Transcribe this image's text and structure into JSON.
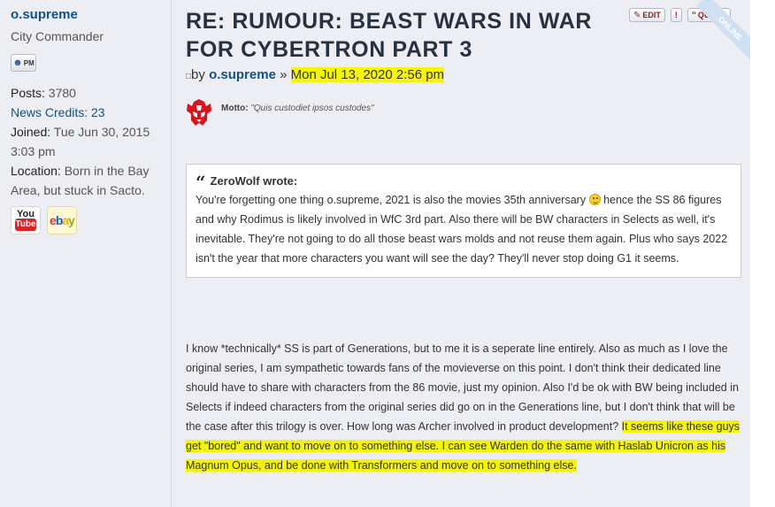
{
  "profile": {
    "username": "o.supreme",
    "rank": "City Commander",
    "pm_label": "PM",
    "posts_label": "Posts:",
    "posts_value": "3780",
    "credits_label": "News Credits: 23",
    "joined_label": "Joined:",
    "joined_value": "Tue Jun 30, 2015 3:03 pm",
    "location_label": "Location:",
    "location_value": "Born in the Bay Area, but stuck in Sacto.",
    "contacts": [
      "YouTube",
      "eBay"
    ]
  },
  "post": {
    "title": "RE: RUMOUR: BEAST WARS IN WAR FOR CYBERTRON PART 3",
    "by_prefix": "by",
    "author": "o.supreme",
    "separator": "»",
    "date": "Mon Jul 13, 2020 2:56 pm",
    "motto_label": "Motto:",
    "motto_text": "\"Quis custodiet ipsos custodes\"",
    "edit_label": "EDIT",
    "report_label": "!",
    "quote_label": "QUOTE",
    "online_label": "ONLINE",
    "quote_author": "ZeroWolf wrote:",
    "quote_part1": "You're forgetting one thing o.supreme, 2021 is also the movies 35th anniversary",
    "quote_part2": "hence the SS 86 figures and why Rodimus is likely involved in WfC 3rd part. Also there will be BW characters in Selects as well, it's inevitable. They're not going to do all those beast wars molds and not reuse them again. Plus who says 2022 isn't the year that more characters you want will see the day? They'll never stop doing G1 it seems.",
    "body_part1": "I know *technically* SS is part of Generations, but to me it is a seperate line entirely. Also as much as I love the original series, I am sympathetic towards fans of the movieverse on this point. I don't think their dedicated line should have to share with characters from the 86 movie, just my opinion. Also I'd be ok with BW being included in Selects if indeed characters from the original series did go on in the Generations line, but I don't think that will be the case after this trilogy is over. How long was Archer involved in product development?",
    "body_part2": "It seems like these guys get \"bored\" and want to move on to something else. I can see Warden do the same with Haslab Unicron as his Magnum Opus, and be done with Transformers and move on to something else."
  },
  "colors": {
    "background": "#eceef3",
    "link": "#105289",
    "title": "#28313f",
    "highlight": "#f5f50a"
  }
}
